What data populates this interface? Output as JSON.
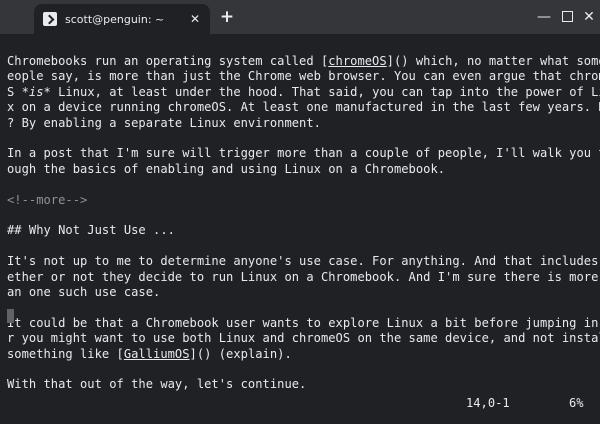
{
  "window": {
    "tab_title": "scott@penguin: ~",
    "tab_close": "✕",
    "new_tab": "+",
    "minimize": "—",
    "close": "✕"
  },
  "editor": {
    "lines": [
      {
        "segments": [
          {
            "text": "Chromebooks run an operating system called ["
          },
          {
            "text": "chromeOS",
            "style": "link"
          },
          {
            "text": "]() which, no matter what some p"
          }
        ]
      },
      {
        "segments": [
          {
            "text": "eople say, is more than just the Chrome web browser. You can even argue that chromeO"
          }
        ]
      },
      {
        "segments": [
          {
            "text": "S "
          },
          {
            "text": "*is*",
            "style": "italic"
          },
          {
            "text": " Linux, at least under the hood. That said, you can tap into the power of Linu"
          }
        ]
      },
      {
        "segments": [
          {
            "text": "x on a device running chromeOS. At least one manufactured in the last few years. How"
          }
        ]
      },
      {
        "segments": [
          {
            "text": "? By enabling a separate Linux environment."
          }
        ]
      },
      {
        "segments": []
      },
      {
        "segments": [
          {
            "text": "In a post that I'm sure will trigger more than a couple of people, I'll walk you thr"
          }
        ]
      },
      {
        "segments": [
          {
            "text": "ough the basics of enabling and using Linux on a Chromebook."
          }
        ]
      },
      {
        "segments": []
      },
      {
        "segments": [
          {
            "text": "<!--more-->",
            "style": "comment"
          }
        ]
      },
      {
        "segments": []
      },
      {
        "segments": [
          {
            "text": "## Why Not Just Use ..."
          }
        ]
      },
      {
        "segments": []
      },
      {
        "segments": [
          {
            "text": "It's not up to me to determine anyone's use case. For anything. And that includes wh"
          }
        ]
      },
      {
        "segments": [
          {
            "text": "ether or not they decide to run Linux on a Chromebook. And I'm sure there is more th"
          }
        ]
      },
      {
        "segments": [
          {
            "text": "an one such use case."
          }
        ]
      },
      {
        "segments": []
      },
      {
        "segments": [
          {
            "text": "It could be that a Chromebook user wants to explore Linux a bit before jumping in. O"
          }
        ]
      },
      {
        "segments": [
          {
            "text": "r you might want to use both Linux and chromeOS on the same device, and not install"
          }
        ]
      },
      {
        "segments": [
          {
            "text": "something like ["
          },
          {
            "text": "GalliumOS",
            "style": "link"
          },
          {
            "text": "]() (explain)."
          }
        ]
      },
      {
        "segments": []
      },
      {
        "segments": [
          {
            "text": "With that out of the way, let's continue."
          }
        ]
      }
    ],
    "status_position": "14,0-1",
    "status_percent": "6%"
  }
}
